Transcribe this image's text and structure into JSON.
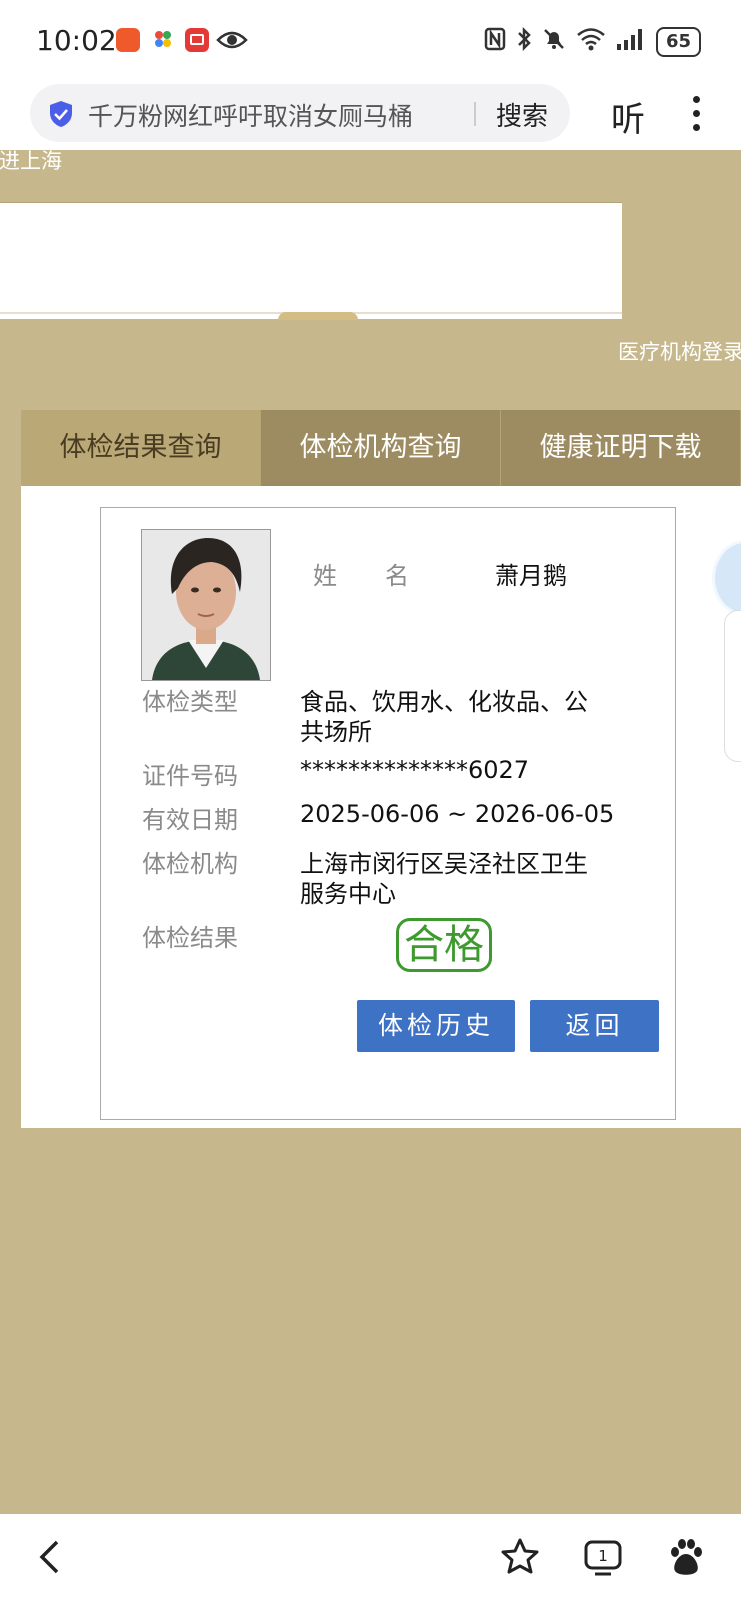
{
  "status_bar": {
    "time": "10:02",
    "battery": "65",
    "icons": [
      "app-badge-icon",
      "app-pinwheel-icon",
      "app-red-icon",
      "eye-icon",
      "nfc-icon",
      "bluetooth-icon",
      "mute-icon",
      "wifi-icon",
      "signal-icon",
      "battery-icon"
    ]
  },
  "browser": {
    "query": "千万粉网红呼吁取消女厕马桶",
    "search_label": "搜索",
    "listen_label": "听"
  },
  "banner": {
    "text": "走进上海",
    "login_link": "医疗机构登录"
  },
  "tabs": [
    {
      "label": "体检结果查询",
      "active": true
    },
    {
      "label": "体检机构查询",
      "active": false
    },
    {
      "label": "健康证明下载",
      "active": false
    }
  ],
  "record": {
    "name_label": "姓　　名",
    "name": "萧月鹅",
    "type_label": "体检类型",
    "type_line1": "食品、饮用水、化妆品、公",
    "type_line2": "共场所",
    "id_label": "证件号码",
    "id_value": "**************6027",
    "date_label": "有效日期",
    "date_value": "2025-06-06 ~ 2026-06-05",
    "org_label": "体检机构",
    "org_line1": "上海市闵行区吴泾社区卫生",
    "org_line2": "服务中心",
    "result_label": "体检结果",
    "result_value": "合格"
  },
  "buttons": {
    "history": "体检历史",
    "back": "返回"
  },
  "colors": {
    "page_bg": "#c7b78c",
    "tab_bar": "#9d8b61",
    "tab_active": "#baa977",
    "button": "#3d72c4",
    "stamp": "#3e9a2f"
  }
}
